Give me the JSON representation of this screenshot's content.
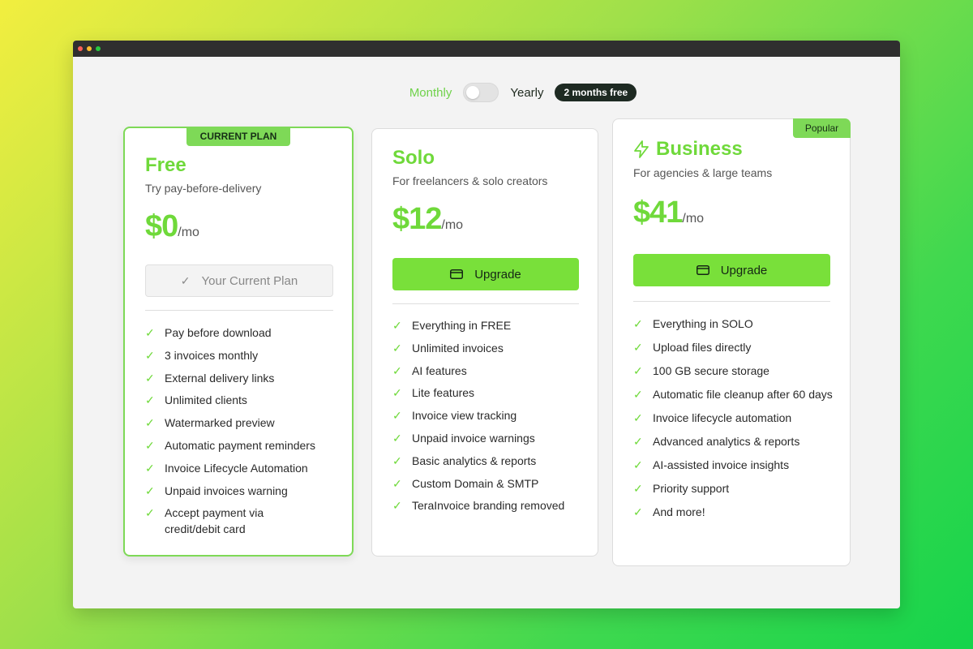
{
  "billing_toggle": {
    "monthly_label": "Monthly",
    "yearly_label": "Yearly",
    "yearly_badge": "2 months free"
  },
  "plans": [
    {
      "tag": "CURRENT PLAN",
      "name": "Free",
      "subtitle": "Try pay-before-delivery",
      "price": "$0",
      "period": "/mo",
      "button_label": "Your Current Plan",
      "features": [
        "Pay before download",
        "3 invoices monthly",
        "External delivery links",
        "Unlimited clients",
        "Watermarked preview",
        "Automatic payment reminders",
        "Invoice Lifecycle Automation",
        "Unpaid invoices warning",
        "Accept payment via credit/debit card"
      ]
    },
    {
      "name": "Solo",
      "subtitle": "For freelancers & solo creators",
      "price": "$12",
      "period": "/mo",
      "button_label": "Upgrade",
      "features": [
        "Everything in FREE",
        "Unlimited invoices",
        "AI features",
        "Lite features",
        "Invoice view tracking",
        "Unpaid invoice warnings",
        "Basic analytics & reports",
        "Custom Domain & SMTP",
        "TeraInvoice branding removed"
      ]
    },
    {
      "tag": "Popular",
      "name": "Business",
      "subtitle": "For agencies & large teams",
      "price": "$41",
      "period": "/mo",
      "button_label": "Upgrade",
      "features": [
        "Everything in SOLO",
        "Upload files directly",
        "100 GB secure storage",
        "Automatic file cleanup after 60 days",
        "Invoice lifecycle automation",
        "Advanced analytics & reports",
        "AI-assisted invoice insights",
        "Priority support",
        "And more!"
      ]
    }
  ],
  "colors": {
    "accent": "#79e03a",
    "accent_text": "#6fd93a",
    "badge_dark": "#1e2a22"
  },
  "icons": {
    "check": "check-icon",
    "card": "credit-card-icon",
    "bolt": "lightning-bolt-icon"
  }
}
